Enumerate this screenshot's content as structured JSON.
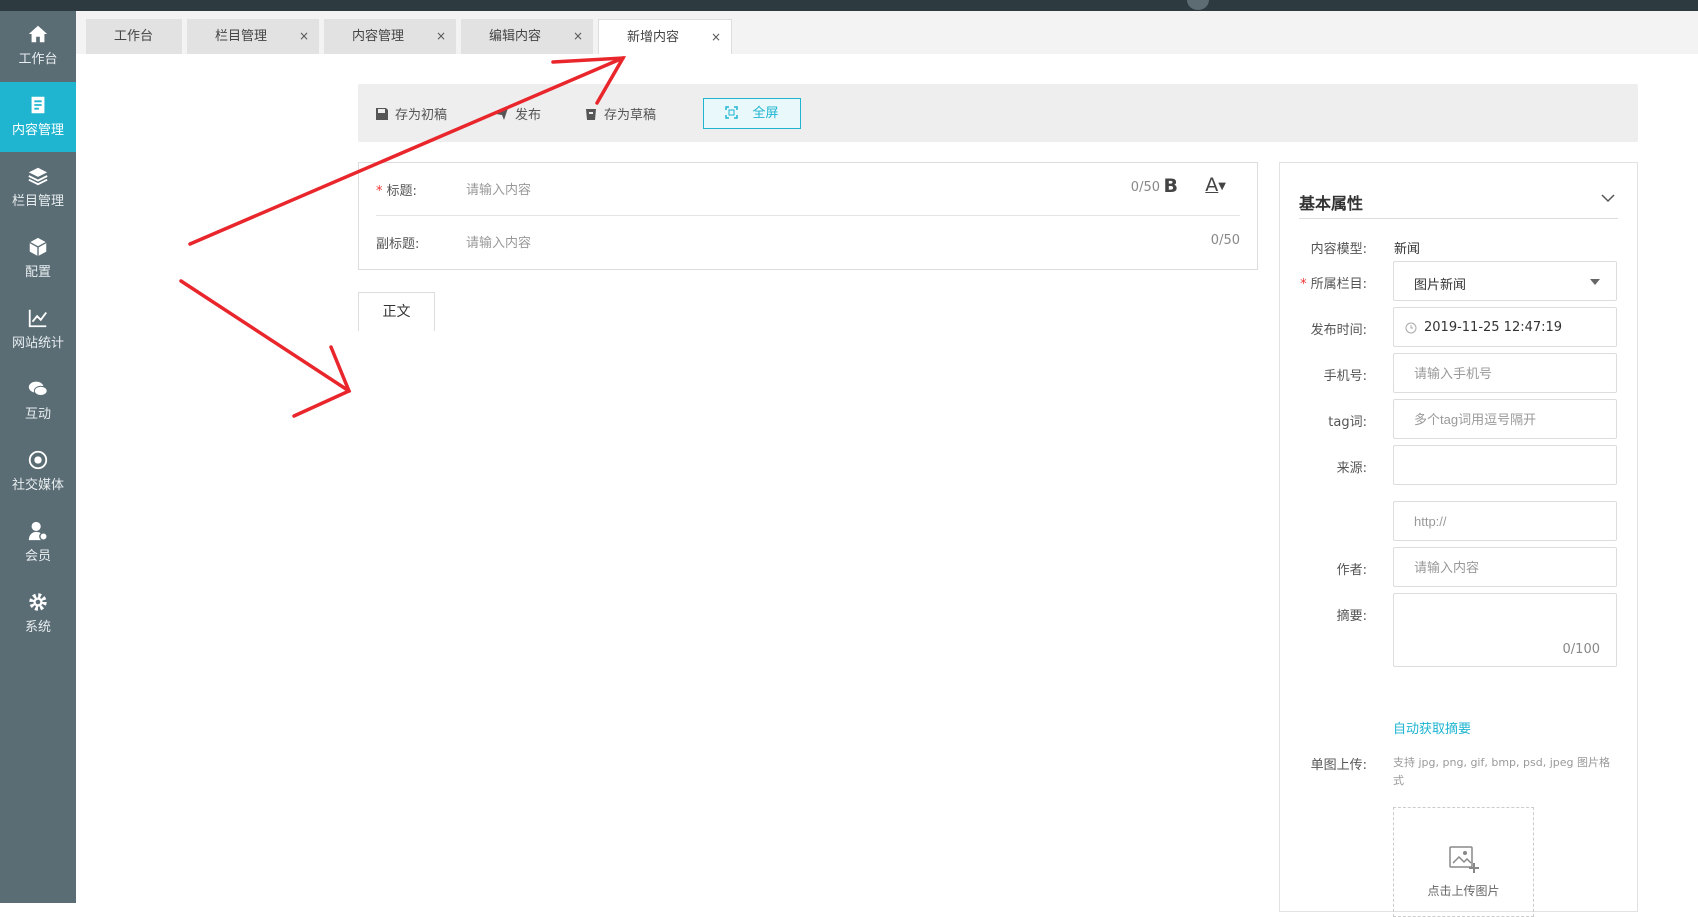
{
  "sidebar": {
    "items": [
      {
        "label": "工作台",
        "icon": "home-icon"
      },
      {
        "label": "内容管理",
        "icon": "document-icon",
        "active": true
      },
      {
        "label": "栏目管理",
        "icon": "layers-icon"
      },
      {
        "label": "配置",
        "icon": "box-icon"
      },
      {
        "label": "网站统计",
        "icon": "chart-icon"
      },
      {
        "label": "互动",
        "icon": "chat-icon"
      },
      {
        "label": "社交媒体",
        "icon": "target-icon"
      },
      {
        "label": "会员",
        "icon": "user-icon"
      },
      {
        "label": "系统",
        "icon": "gear-icon"
      }
    ]
  },
  "tabs": [
    {
      "label": "工作台"
    },
    {
      "label": "栏目管理",
      "close": "×"
    },
    {
      "label": "内容管理",
      "close": "×"
    },
    {
      "label": "编辑内容",
      "close": "×"
    },
    {
      "label": "新增内容",
      "close": "×",
      "active": true
    }
  ],
  "toolbar": {
    "save_initial": "存为初稿",
    "publish": "发布",
    "save_draft": "存为草稿",
    "fullscreen": "全屏"
  },
  "editor": {
    "title_required": "*",
    "title_label": "标题:",
    "title_placeholder": "请输入内容",
    "title_count": "0/50",
    "bold": "B",
    "color": "A",
    "subtitle_label": "副标题:",
    "subtitle_placeholder": "请输入内容",
    "subtitle_count": "0/50",
    "body_tab": "正文"
  },
  "panel": {
    "title": "基本属性",
    "model_label": "内容模型:",
    "model_value": "新闻",
    "column_required": "*",
    "column_label": "所属栏目:",
    "column_value": "图片新闻",
    "time_label": "发布时间:",
    "time_value": "2019-11-25 12:47:19",
    "phone_label": "手机号:",
    "phone_placeholder": "请输入手机号",
    "tag_label": "tag词:",
    "tag_placeholder": "多个tag词用逗号隔开",
    "source_label": "来源:",
    "source_value": "",
    "url_placeholder": "http://",
    "author_label": "作者:",
    "author_placeholder": "请输入内容",
    "summary_label": "摘要:",
    "summary_count": "0/100",
    "auto_summary": "自动获取摘要",
    "image_label": "单图上传:",
    "image_hint": "支持 jpg, png, gif, bmp, psd, jpeg 图片格式",
    "upload_text": "点击上传图片"
  },
  "colors": {
    "accent": "#1fb5d1",
    "sidebar": "#5a6c74",
    "annotation_arrows": "#e8262c"
  }
}
